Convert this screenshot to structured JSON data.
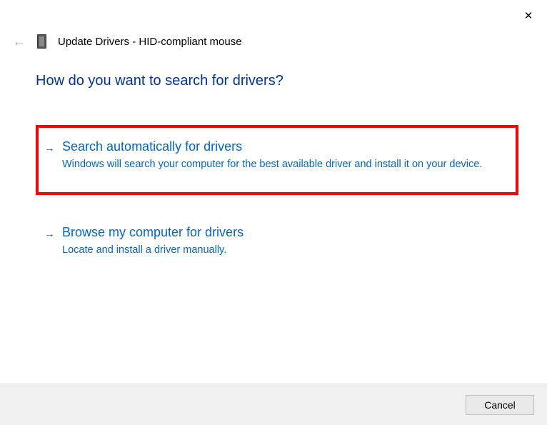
{
  "window": {
    "title": "Update Drivers - HID-compliant mouse"
  },
  "heading": "How do you want to search for drivers?",
  "options": [
    {
      "title": "Search automatically for drivers",
      "description": "Windows will search your computer for the best available driver and install it on your device."
    },
    {
      "title": "Browse my computer for drivers",
      "description": "Locate and install a driver manually."
    }
  ],
  "footer": {
    "cancel_label": "Cancel"
  }
}
